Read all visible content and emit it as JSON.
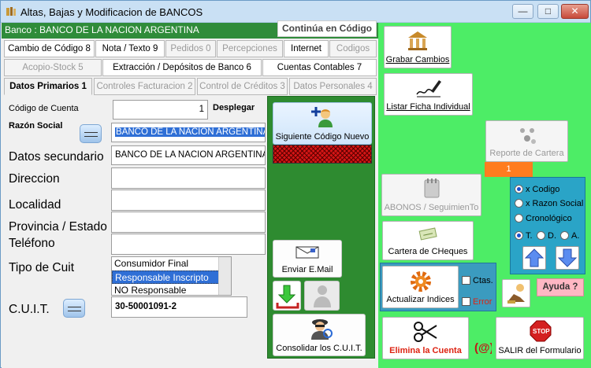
{
  "window": {
    "title": "Altas, Bajas y Modificacion de BANCOS",
    "minimize": "—",
    "maximize": "□",
    "close": "✕"
  },
  "header": {
    "banco_label": "Banco : BANCO DE LA NACION ARGENTINA",
    "continua": "Continúa en Código"
  },
  "tabs_row1": [
    "Cambio de Código 8",
    "Nota / Texto 9",
    "Pedidos 0",
    "Percepciones",
    "Internet",
    "Codigos"
  ],
  "tabs_row2": [
    "Acopio-Stock 5",
    "Extracción / Depósitos de Banco 6",
    "Cuentas Contables 7"
  ],
  "tabs_row3": [
    "Datos Primarios 1",
    "Controles Facturacion 2",
    "Control de Créditos 3",
    "Datos Personales 4"
  ],
  "form": {
    "codigo_label": "Código de Cuenta",
    "codigo_value": "1",
    "desplegar": "Desplegar",
    "razon_label": "Razón Social",
    "razon_value": "BANCO DE LA NACION ARGENTINA",
    "secundarios_label": "Datos secundario",
    "secundarios_value": "BANCO DE LA NACION ARGENTINA",
    "direccion_label": "Direccion",
    "localidad_label": "Localidad",
    "provincia_label": "Provincia / Estado",
    "telefono_label": "Teléfono",
    "tipo_cuit_label": "Tipo de Cuit",
    "tipo_cuit_options": [
      "Consumidor Final",
      "Responsable Inscripto",
      "NO Responsable"
    ],
    "tipo_cuit_selected": "Responsable Inscripto",
    "cuit_label": "C.U.I.T.",
    "cuit_value": "30-50001091-2"
  },
  "green_column": {
    "siguiente": "Siguiente Código Nuevo",
    "enviar": "Enviar E.Mail",
    "consolidar": "Consolidar los C.U.I.T."
  },
  "right_panel": {
    "grabar": "Grabar Cambios",
    "listar": "Listar Ficha Individual",
    "reporte": "Reporte de Cartera",
    "reporte_value": "1",
    "abonos": "ABONOS / SeguimienTo",
    "cartera": "Cartera de CHeques",
    "actualizar": "Actualizar Indices",
    "ctas": "Ctas.",
    "error": "Error",
    "ayuda": "Ayuda ?",
    "elimina": "Elimina la Cuenta",
    "salir": "SALIR del Formulario",
    "orden_options": [
      "x Codigo",
      "x Razon Social",
      "Cronológico"
    ],
    "orden_selected": "x Codigo",
    "filtro_options": [
      "T.",
      "D.",
      "A."
    ],
    "filtro_selected": "T."
  },
  "colors": {
    "green_dark": "#2e8b30",
    "green_light": "#4ded66",
    "accent_blue": "#2aa4c7",
    "orange": "#ff7c1f",
    "banner": "#2f8c3a"
  }
}
